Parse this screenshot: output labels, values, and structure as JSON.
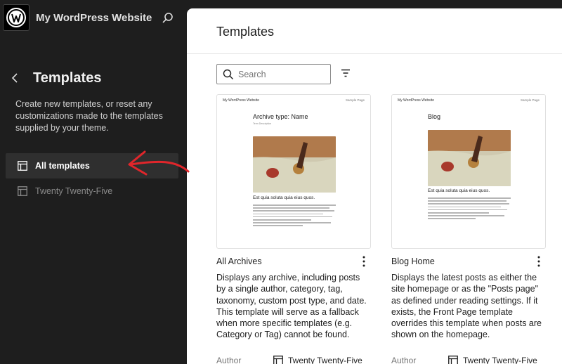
{
  "sidebar": {
    "site_title": "My WordPress Website",
    "section_title": "Templates",
    "description": "Create new templates, or reset any customizations made to the templates supplied by your theme.",
    "items": [
      {
        "label": "All templates",
        "active": true,
        "icon": "layout-icon"
      },
      {
        "label": "Twenty Twenty-Five",
        "active": false,
        "icon": "layout-icon"
      }
    ]
  },
  "main": {
    "title": "Templates",
    "search": {
      "placeholder": "Search",
      "value": ""
    },
    "cards": [
      {
        "title": "All Archives",
        "description": "Displays any archive, including posts by a single author, category, tag, taxonomy, custom post type, and date. This template will serve as a fallback when more specific templates (e.g. Category or Tag) cannot be found.",
        "author_label": "Author",
        "theme": "Twenty Twenty-Five",
        "preview": {
          "site": "My WordPress Website",
          "page": "Sample Page",
          "heading": "Archive type: Name",
          "sub": "Term Description",
          "caption": "Est quia soluta quia eius quos."
        }
      },
      {
        "title": "Blog Home",
        "description": "Displays the latest posts as either the site homepage or as the \"Posts page\" as defined under reading settings. If it exists, the Front Page template overrides this template when posts are shown on the homepage.",
        "author_label": "Author",
        "theme": "Twenty Twenty-Five",
        "preview": {
          "site": "My WordPress Website",
          "page": "Sample Page",
          "heading": "Blog",
          "sub": "",
          "caption": "Est quia soluta quia eius quos."
        }
      }
    ]
  },
  "colors": {
    "sidebar_bg": "#1e1e1e",
    "active_item_bg": "#2f2f2f",
    "annotation_arrow": "#e0262b",
    "main_bg": "#ffffff"
  }
}
